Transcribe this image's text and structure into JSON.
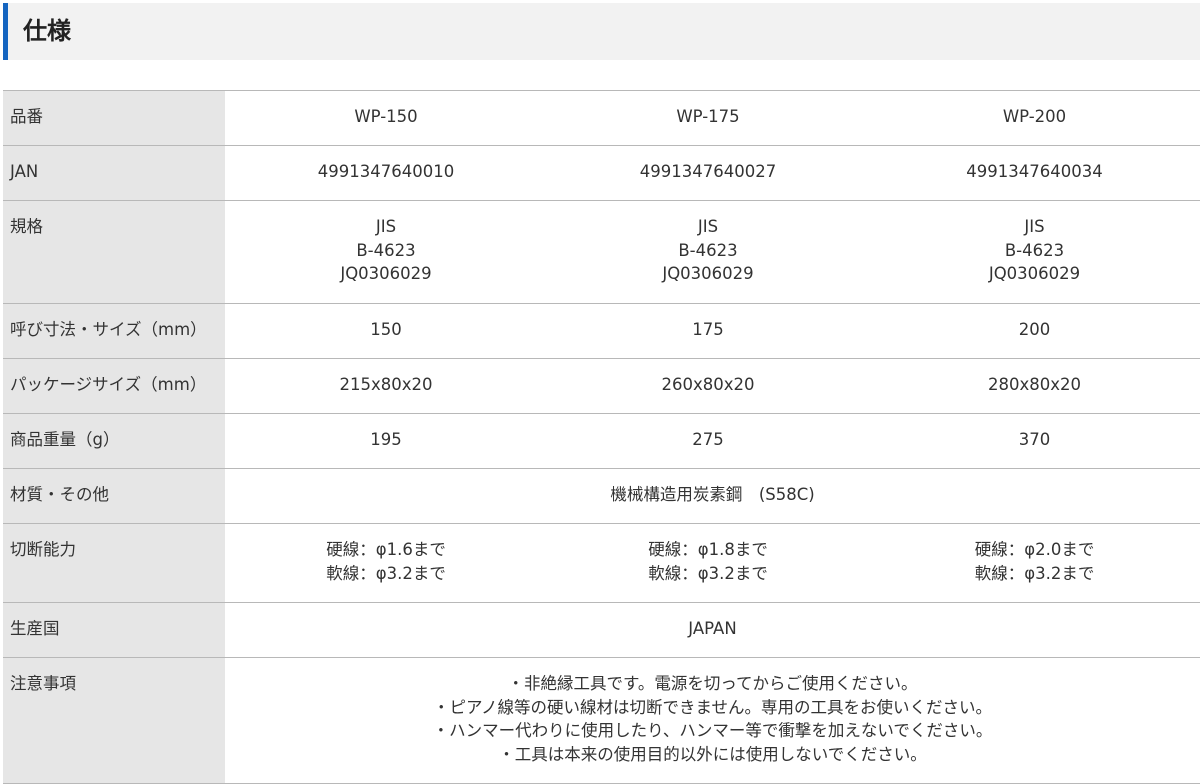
{
  "section": {
    "title": "仕様"
  },
  "rows": [
    {
      "label": "品番",
      "values": [
        [
          "WP-150"
        ],
        [
          "WP-175"
        ],
        [
          "WP-200"
        ]
      ]
    },
    {
      "label": "JAN",
      "values": [
        [
          "4991347640010"
        ],
        [
          "4991347640027"
        ],
        [
          "4991347640034"
        ]
      ]
    },
    {
      "label": "規格",
      "values": [
        [
          "JIS",
          "B-4623",
          "JQ0306029"
        ],
        [
          "JIS",
          "B-4623",
          "JQ0306029"
        ],
        [
          "JIS",
          "B-4623",
          "JQ0306029"
        ]
      ]
    },
    {
      "label": "呼び寸法・サイズ（mm）",
      "values": [
        [
          "150"
        ],
        [
          "175"
        ],
        [
          "200"
        ]
      ]
    },
    {
      "label": "パッケージサイズ（mm）",
      "values": [
        [
          "215x80x20"
        ],
        [
          "260x80x20"
        ],
        [
          "280x80x20"
        ]
      ]
    },
    {
      "label": "商品重量（g）",
      "values": [
        [
          "195"
        ],
        [
          "275"
        ],
        [
          "370"
        ]
      ]
    },
    {
      "label": "材質・その他",
      "span": [
        "機械構造用炭素鋼　(S58C)"
      ]
    },
    {
      "label": "切断能力",
      "values": [
        [
          "硬線：φ1.6まで",
          "軟線：φ3.2まで"
        ],
        [
          "硬線：φ1.8まで",
          "軟線：φ3.2まで"
        ],
        [
          "硬線：φ2.0まで",
          "軟線：φ3.2まで"
        ]
      ]
    },
    {
      "label": "生産国",
      "span": [
        "JAPAN"
      ]
    },
    {
      "label": "注意事項",
      "span": [
        "・非絶縁工具です。電源を切ってからご使用ください。",
        "・ピアノ線等の硬い線材は切断できません。専用の工具をお使いください。",
        "・ハンマー代わりに使用したり、ハンマー等で衝撃を加えないでください。",
        "・工具は本来の使用目的以外には使用しないでください。"
      ]
    }
  ]
}
